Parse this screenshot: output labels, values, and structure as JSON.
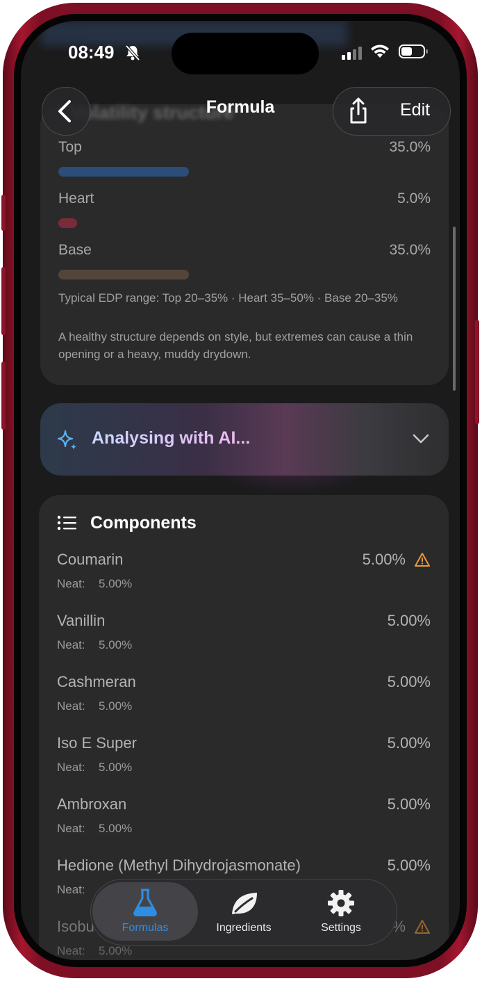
{
  "status_bar": {
    "time": "08:49"
  },
  "nav": {
    "title": "Formula",
    "edit_label": "Edit",
    "ghost_section_title": "Volatility structure"
  },
  "volatility": {
    "rows": [
      {
        "label": "Top",
        "value": "35.0%",
        "color": "#2a4d7a"
      },
      {
        "label": "Heart",
        "value": "5.0%",
        "color": "#7a2b3a"
      },
      {
        "label": "Base",
        "value": "35.0%",
        "color": "#54453a"
      }
    ],
    "range_note": "Typical EDP range: Top 20–35% · Heart 35–50% · Base 20–35%",
    "health_note": "A healthy structure depends on style, but extremes can cause a thin opening or a heavy, muddy drydown."
  },
  "ai_banner": {
    "label": "Analysing with AI..."
  },
  "components": {
    "title": "Components",
    "neat_label": "Neat:",
    "items": [
      {
        "name": "Coumarin",
        "percent": "5.00%",
        "neat": "5.00%"
      },
      {
        "name": "Vanillin",
        "percent": "5.00%",
        "neat": "5.00%"
      },
      {
        "name": "Cashmeran",
        "percent": "5.00%",
        "neat": "5.00%"
      },
      {
        "name": "Iso E Super",
        "percent": "5.00%",
        "neat": "5.00%"
      },
      {
        "name": "Ambroxan",
        "percent": "5.00%",
        "neat": "5.00%"
      },
      {
        "name": "Hedione (Methyl Dihydrojasmonate)",
        "percent": "5.00%",
        "neat": "Neat:"
      },
      {
        "name": "Isobu",
        "percent": "%",
        "neat": "5.00%"
      }
    ]
  },
  "tab_bar": {
    "tabs": [
      {
        "label": "Formulas",
        "active": true
      },
      {
        "label": "Ingredients",
        "active": false
      },
      {
        "label": "Settings",
        "active": false
      }
    ]
  },
  "colors": {
    "accent_blue": "#2f8de4",
    "warning": "#e89a3c",
    "ai_sparkle": "#5ab4f0"
  }
}
